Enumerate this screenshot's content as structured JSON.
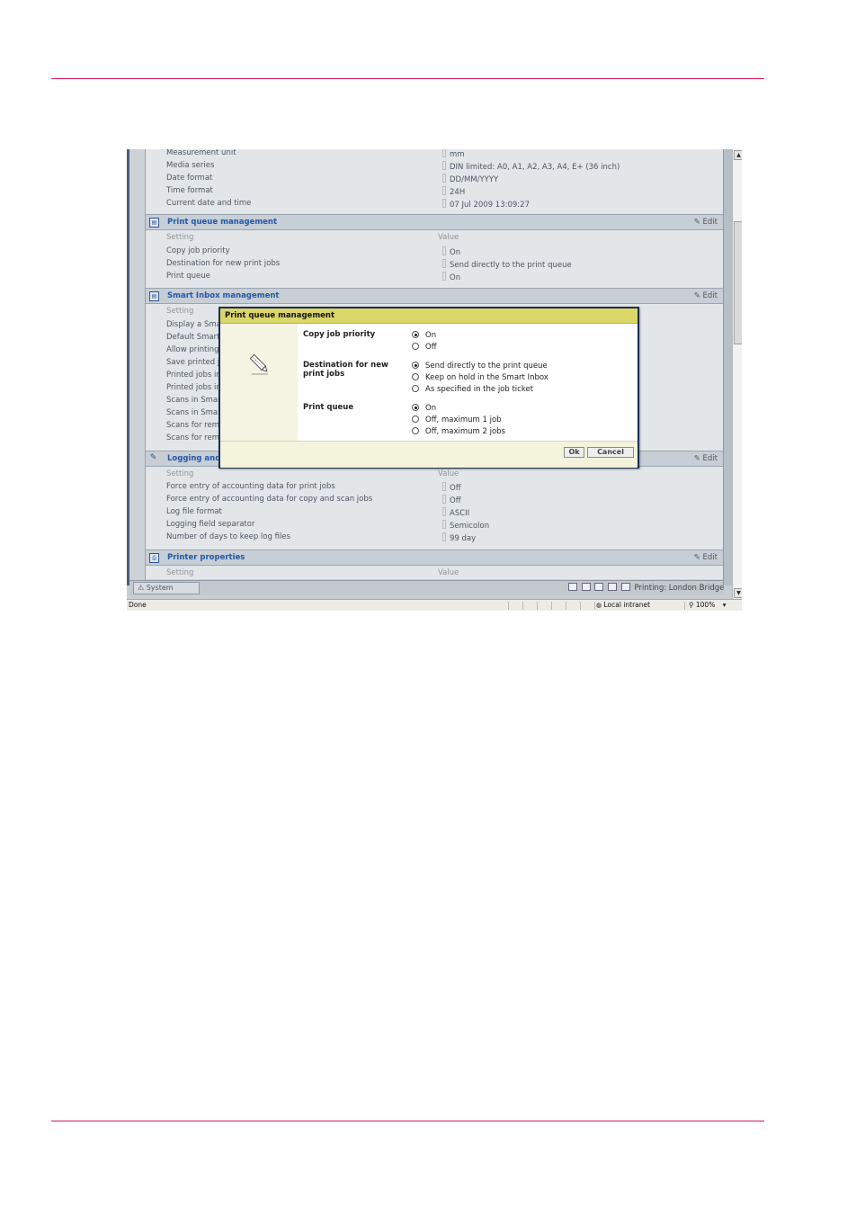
{
  "screen": {
    "top_rows": [
      {
        "label": "Measurement unit",
        "value": "mm"
      },
      {
        "label": "Media series",
        "value": "DIN limited: A0, A1, A2, A3, A4, E+ (36 inch)"
      },
      {
        "label": "Date format",
        "value": "DD/MM/YYYY"
      },
      {
        "label": "Time format",
        "value": "24H"
      },
      {
        "label": "Current date and time",
        "value": "07 Jul 2009 13:09:27"
      }
    ],
    "sections": [
      {
        "title": "Print queue management",
        "edit": "Edit",
        "col_setting": "Setting",
        "col_value": "Value",
        "rows": [
          {
            "label": "Copy job priority",
            "value": "On"
          },
          {
            "label": "Destination for new print jobs",
            "value": "Send directly to the print queue"
          },
          {
            "label": "Print queue",
            "value": "On"
          }
        ]
      },
      {
        "title": "Smart Inbox management",
        "edit": "Edit",
        "col_setting": "Setting",
        "rows": [
          {
            "label": "Display a Smar"
          },
          {
            "label": "Default Smart I"
          },
          {
            "label": "Allow printing f"
          },
          {
            "label": "Save printed jo"
          },
          {
            "label": "Printed jobs in"
          },
          {
            "label": "Printed jobs in"
          },
          {
            "label": "Scans in Smart"
          },
          {
            "label": "Scans in Smart"
          },
          {
            "label": "Scans for remo"
          },
          {
            "label": "Scans for remo"
          }
        ]
      },
      {
        "title": "Logging and a",
        "edit": "Edit",
        "col_setting": "Setting",
        "col_value": "Value",
        "rows": [
          {
            "label": "Force entry of accounting data for print jobs",
            "value": "Off"
          },
          {
            "label": "Force entry of accounting data for copy and scan jobs",
            "value": "Off"
          },
          {
            "label": "Log file format",
            "value": "ASCII"
          },
          {
            "label": "Logging field separator",
            "value": "Semicolon"
          },
          {
            "label": "Number of days to keep log files",
            "value": "99 day"
          }
        ]
      },
      {
        "title": "Printer properties",
        "edit": "Edit",
        "col_setting": "Setting",
        "col_value": "Value"
      }
    ],
    "tab": "System",
    "printing_status": "Printing:  London Bridge",
    "statusbar": {
      "left": "Done",
      "zone": "Local intranet",
      "zoom": "100%"
    }
  },
  "dialog": {
    "title": "Print queue management",
    "groups": [
      {
        "label": "Copy job priority",
        "options": [
          {
            "text": "On",
            "selected": true
          },
          {
            "text": "Off",
            "selected": false
          }
        ]
      },
      {
        "label": "Destination for new print jobs",
        "options": [
          {
            "text": "Send directly to the print queue",
            "selected": true
          },
          {
            "text": "Keep on hold in the Smart Inbox",
            "selected": false
          },
          {
            "text": "As specified in the job ticket",
            "selected": false
          }
        ]
      },
      {
        "label": "Print queue",
        "options": [
          {
            "text": "On",
            "selected": true
          },
          {
            "text": "Off, maximum 1 job",
            "selected": false
          },
          {
            "text": "Off, maximum 2 jobs",
            "selected": false
          }
        ]
      }
    ],
    "ok_label": "Ok",
    "cancel_label": "Cancel"
  }
}
